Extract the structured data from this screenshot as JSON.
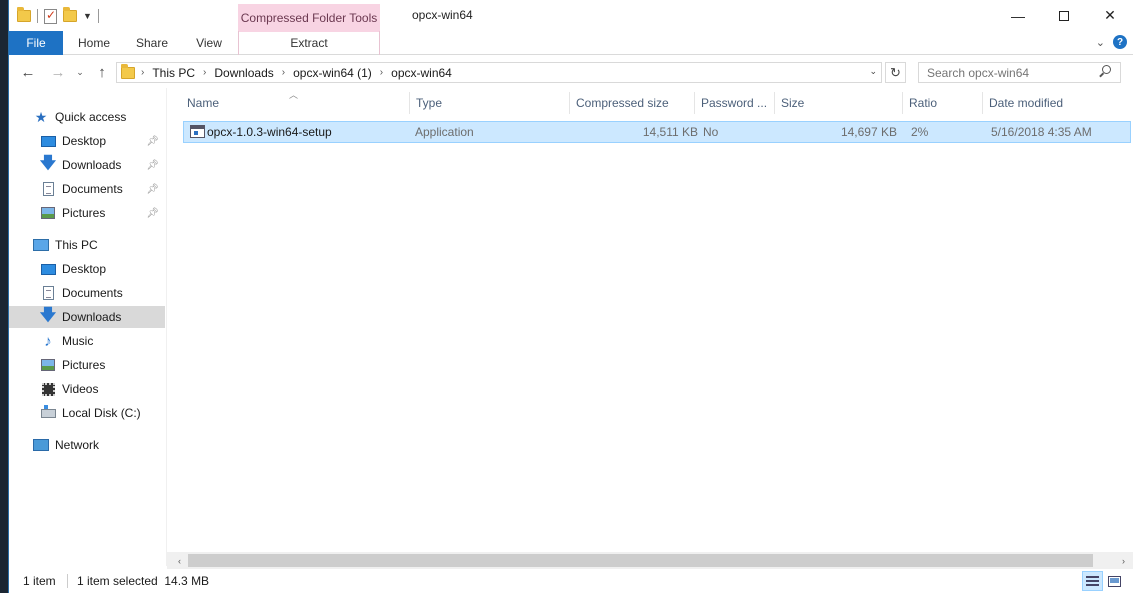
{
  "window": {
    "title": "opcx-win64",
    "context_tab": "Compressed Folder Tools"
  },
  "ribbon": {
    "tabs": [
      "File",
      "Home",
      "Share",
      "View",
      "Extract"
    ],
    "help": "?"
  },
  "address": {
    "crumbs": [
      "This PC",
      "Downloads",
      "opcx-win64 (1)",
      "opcx-win64"
    ]
  },
  "search": {
    "placeholder": "Search opcx-win64"
  },
  "nav": {
    "quick_access": "Quick access",
    "qa_items": [
      "Desktop",
      "Downloads",
      "Documents",
      "Pictures"
    ],
    "this_pc": "This PC",
    "pc_items": [
      "Desktop",
      "Documents",
      "Downloads",
      "Music",
      "Pictures",
      "Videos",
      "Local Disk (C:)"
    ],
    "network": "Network",
    "selected": "Downloads"
  },
  "columns": [
    "Name",
    "Type",
    "Compressed size",
    "Password ...",
    "Size",
    "Ratio",
    "Date modified"
  ],
  "files": [
    {
      "name": "opcx-1.0.3-win64-setup",
      "type": "Application",
      "compressed_size": "14,511 KB",
      "password": "No",
      "size": "14,697 KB",
      "ratio": "2%",
      "date_modified": "5/16/2018 4:35 AM"
    }
  ],
  "status": {
    "item_count": "1 item",
    "selection": "1 item selected  14.3 MB"
  },
  "icons": [
    "folder-icon",
    "properties-icon",
    "back-arrow-icon",
    "forward-arrow-icon",
    "up-arrow-icon",
    "refresh-icon",
    "search-icon",
    "star-icon",
    "desktop-icon",
    "download-arrow-icon",
    "document-icon",
    "pictures-icon",
    "pin-icon",
    "computer-icon",
    "music-note-icon",
    "videos-icon",
    "local-disk-icon",
    "network-icon",
    "application-icon",
    "details-view-icon",
    "tiles-view-icon"
  ]
}
